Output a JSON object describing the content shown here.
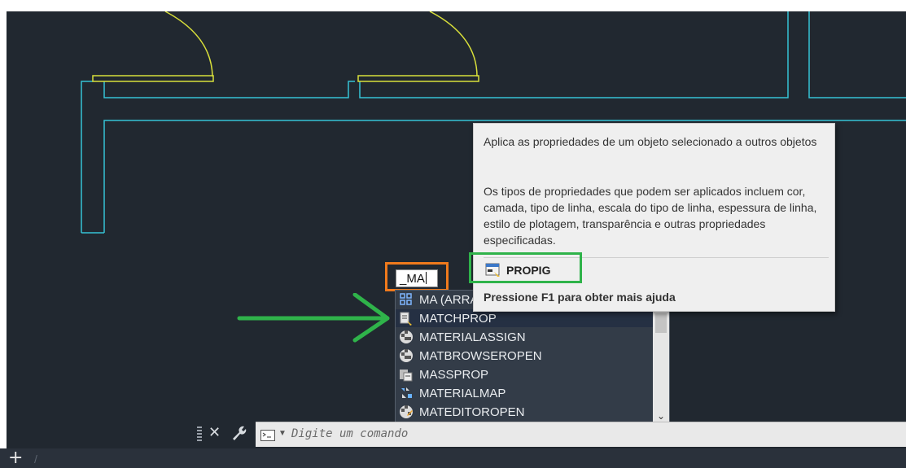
{
  "command_input": {
    "value": "_MA"
  },
  "autocomplete": {
    "items": [
      {
        "label": "MA (ARRA",
        "icon": "array-icon"
      },
      {
        "label": "MATCHPROP",
        "icon": "match-properties-icon",
        "selected": true
      },
      {
        "label": "MATERIALASSIGN",
        "icon": "material-sphere-icon"
      },
      {
        "label": "MATBROWSEROPEN",
        "icon": "material-sphere-icon"
      },
      {
        "label": "MASSPROP",
        "icon": "mass-properties-icon"
      },
      {
        "label": "MATERIALMAP",
        "icon": "material-map-icon"
      },
      {
        "label": "MATEDITOROPEN",
        "icon": "material-editor-icon"
      }
    ]
  },
  "tooltip": {
    "desc1": "Aplica as propriedades de um objeto selecionado a outros objetos",
    "desc2": "Os tipos de propriedades que podem ser aplicados incluem cor, camada, tipo de linha, escala do tipo de linha, espessura de linha, estilo de plotagem, transparência e outras propriedades especificadas.",
    "command_name": "PROPIG",
    "help_text": "Pressione F1 para obter mais ajuda"
  },
  "command_line": {
    "placeholder": "Digite um comando"
  },
  "bottom_bar": {
    "plus": "+",
    "separator": "/"
  },
  "colors": {
    "canvas_bg": "#212830",
    "wall_lines": "#36c3d6",
    "door_lines": "#d8df3a",
    "orange_highlight": "#f07a1c",
    "green_highlight": "#2fb34a"
  }
}
